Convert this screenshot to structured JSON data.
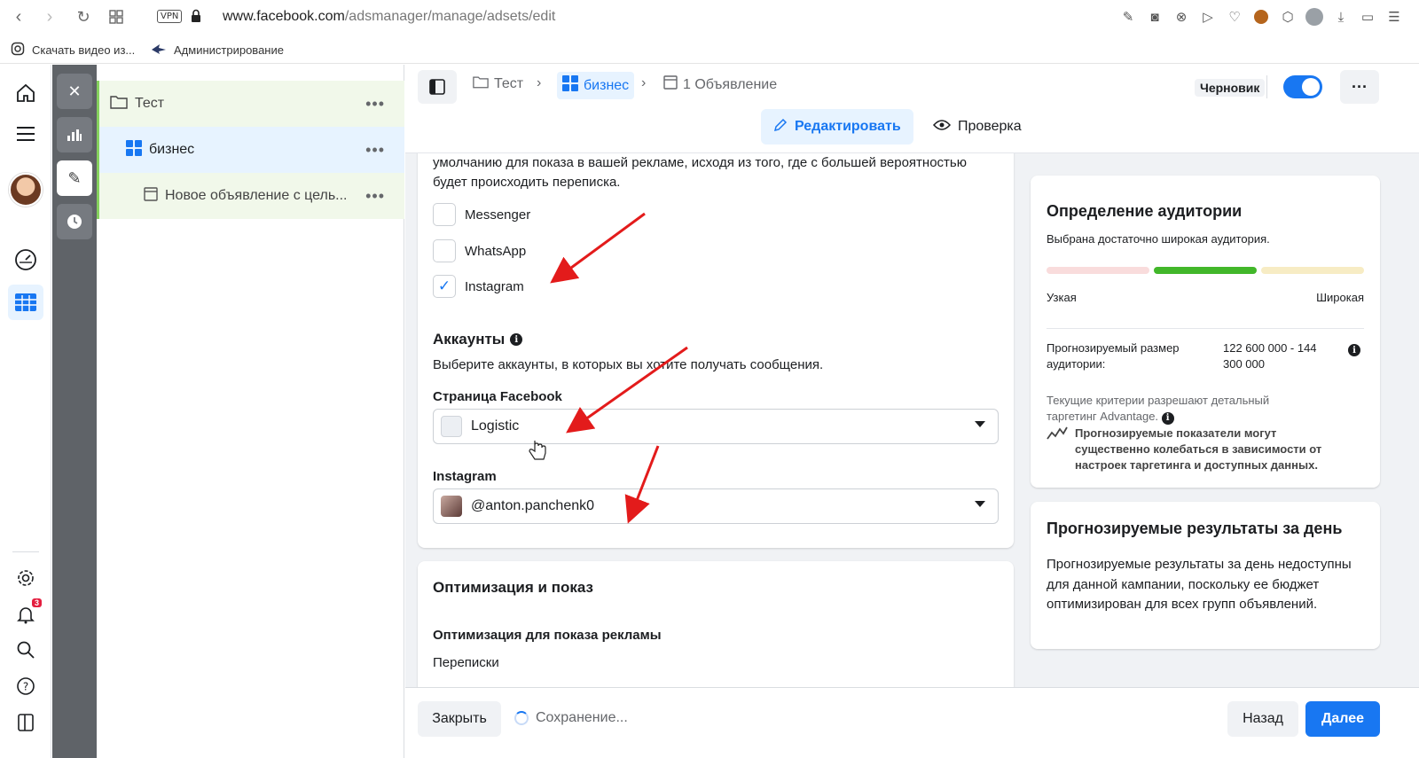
{
  "browser": {
    "url_host": "www.facebook.com",
    "url_path": "/adsmanager/manage/adsets/edit",
    "vpn_label": "VPN",
    "bookmarks": [
      {
        "label": "Скачать видео из...",
        "icon": "instagram-icon"
      },
      {
        "label": "Администрирование",
        "icon": "shark-icon"
      }
    ]
  },
  "global_nav": {
    "notification_count": "3"
  },
  "tree": {
    "items": [
      {
        "label": "Тест",
        "icon": "folder-icon"
      },
      {
        "label": "бизнес",
        "icon": "grid-icon"
      },
      {
        "label": "Новое объявление с цель...",
        "icon": "ad-icon"
      }
    ]
  },
  "header": {
    "breadcrumbs": [
      {
        "label": "Тест",
        "icon": "folder-icon"
      },
      {
        "label": "бизнес",
        "icon": "grid-icon"
      },
      {
        "label": "1 Объявление",
        "icon": "ad-icon"
      }
    ],
    "status": "Черновик",
    "toggle_on": true,
    "tabs": {
      "edit": "Редактировать",
      "review": "Проверка"
    }
  },
  "messaging": {
    "intro": "умолчанию для показа в вашей рекламе, исходя из того, где с большей вероятностью будет происходить переписка.",
    "options": [
      {
        "label": "Messenger",
        "checked": false
      },
      {
        "label": "WhatsApp",
        "checked": false
      },
      {
        "label": "Instagram",
        "checked": true
      }
    ]
  },
  "accounts": {
    "title": "Аккаунты",
    "description": "Выберите аккаунты, в которых вы хотите получать сообщения.",
    "facebook_label": "Страница Facebook",
    "facebook_value": "Logistic",
    "instagram_label": "Instagram",
    "instagram_value": "@anton.panchenk0"
  },
  "optimization": {
    "title": "Оптимизация и показ",
    "subtitle": "Оптимизация для показа рекламы",
    "value": "Переписки"
  },
  "audience": {
    "title": "Определение аудитории",
    "subtitle": "Выбрана достаточно широкая аудитория.",
    "narrow": "Узкая",
    "broad": "Широкая",
    "size_label": "Прогнозируемый размер аудитории:",
    "size_value": "122 600 000 - 144 300 000",
    "criteria": "Текущие критерии разрешают детальный таргетинг Advantage.",
    "warning": "Прогнозируемые показатели могут существенно колебаться в зависимости от настроек таргетинга и доступных данных.",
    "colors": {
      "narrow": "#f9dcdc",
      "mid": "#42b72a",
      "broad": "#f7ecc4"
    }
  },
  "results": {
    "title": "Прогнозируемые результаты за день",
    "text": "Прогнозируемые результаты за день недоступны для данной кампании, поскольку ее бюджет оптимизирован для всех групп объявлений."
  },
  "footer": {
    "close": "Закрыть",
    "saving": "Сохранение...",
    "back": "Назад",
    "next": "Далее"
  },
  "colors": {
    "accent": "#1877f2",
    "annotation_arrow": "#e31b1b"
  }
}
